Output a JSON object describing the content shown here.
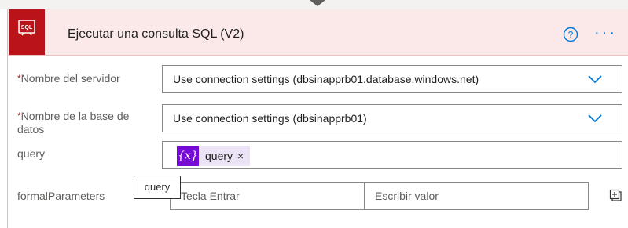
{
  "action": {
    "title": "Ejecutar una consulta SQL (V2)",
    "badge_text": "SQL",
    "icons": {
      "connector": "sql-database-icon",
      "help": "help-circle-icon",
      "menu": "more-horizontal-icon"
    },
    "colors": {
      "accent": "#ba141a",
      "header_bg": "#fbe9ea",
      "link": "#0078d4",
      "token": "#770bd6"
    }
  },
  "fields": {
    "server": {
      "required_mark": "*",
      "label": "Nombre del servidor",
      "value": "Use connection settings (dbsinapprb01.database.windows.net)"
    },
    "database": {
      "required_mark": "*",
      "label_line1": "Nombre de la base de",
      "label_line2": "datos",
      "value": "Use connection settings (dbsinapprb01)"
    },
    "query": {
      "label": "query",
      "token": {
        "icon_text": "{x}",
        "label": "query",
        "remove": "×"
      }
    },
    "formalParameters": {
      "label": "formalParameters",
      "key_placeholder": "Tecla Entrar",
      "value_placeholder": "Escribir valor"
    }
  },
  "tooltip": {
    "text": "query"
  }
}
